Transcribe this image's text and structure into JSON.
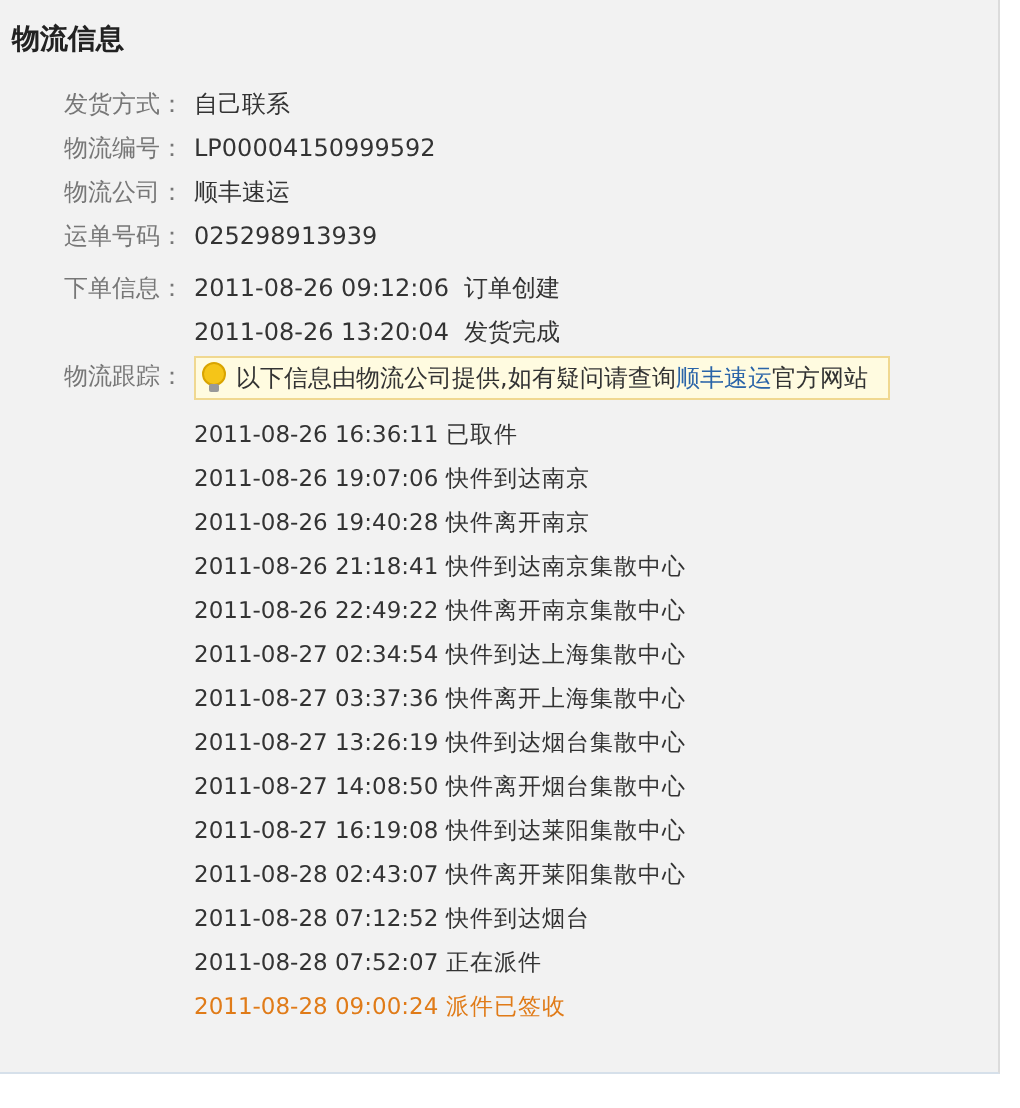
{
  "title": "物流信息",
  "fields": [
    {
      "label": "发货方式：",
      "value": "自己联系"
    },
    {
      "label": "物流编号：",
      "value": "LP00004150999592"
    },
    {
      "label": "物流公司：",
      "value": "顺丰速运"
    },
    {
      "label": "运单号码：",
      "value": "025298913939"
    }
  ],
  "order_info": {
    "label": "下单信息：",
    "events": [
      {
        "time": "2011-08-26 09:12:06",
        "text": "订单创建"
      },
      {
        "time": "2011-08-26 13:20:04",
        "text": "发货完成"
      }
    ]
  },
  "tracking": {
    "label": "物流跟踪：",
    "notice": {
      "before": "以下信息由物流公司提供,如有疑问请查询",
      "link": "顺丰速运",
      "after": "官方网站"
    },
    "events": [
      {
        "time": "2011-08-26 16:36:11",
        "text": "已取件",
        "latest": false
      },
      {
        "time": "2011-08-26 19:07:06",
        "text": "快件到达南京",
        "latest": false
      },
      {
        "time": "2011-08-26 19:40:28",
        "text": "快件离开南京",
        "latest": false
      },
      {
        "time": "2011-08-26 21:18:41",
        "text": "快件到达南京集散中心",
        "latest": false
      },
      {
        "time": "2011-08-26 22:49:22",
        "text": "快件离开南京集散中心",
        "latest": false
      },
      {
        "time": "2011-08-27 02:34:54",
        "text": "快件到达上海集散中心",
        "latest": false
      },
      {
        "time": "2011-08-27 03:37:36",
        "text": "快件离开上海集散中心",
        "latest": false
      },
      {
        "time": "2011-08-27 13:26:19",
        "text": "快件到达烟台集散中心",
        "latest": false
      },
      {
        "time": "2011-08-27 14:08:50",
        "text": "快件离开烟台集散中心",
        "latest": false
      },
      {
        "time": "2011-08-27 16:19:08",
        "text": "快件到达莱阳集散中心",
        "latest": false
      },
      {
        "time": "2011-08-28 02:43:07",
        "text": "快件离开莱阳集散中心",
        "latest": false
      },
      {
        "time": "2011-08-28 07:12:52",
        "text": "快件到达烟台",
        "latest": false
      },
      {
        "time": "2011-08-28 07:52:07",
        "text": "正在派件",
        "latest": false
      },
      {
        "time": "2011-08-28 09:00:24",
        "text": "派件已签收",
        "latest": true
      }
    ]
  }
}
